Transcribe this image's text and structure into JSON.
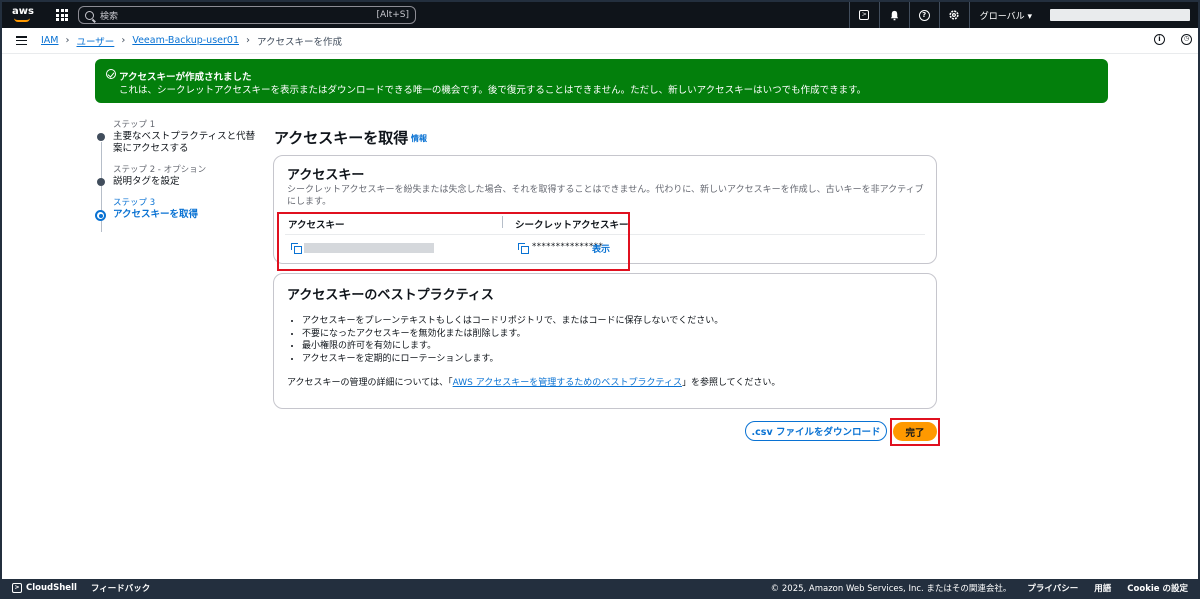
{
  "topnav": {
    "logo": "aws",
    "search_placeholder": "検索",
    "search_shortcut": "[Alt+S]",
    "region": "グローバル ▾",
    "icons": [
      "cloudshell-icon",
      "bell-icon",
      "help-icon",
      "settings-icon"
    ]
  },
  "breadcrumb": {
    "items": [
      "IAM",
      "ユーザー",
      "Veeam-Backup-user01"
    ],
    "current": "アクセスキーを作成"
  },
  "flash": {
    "title": "アクセスキーが作成されました",
    "message": "これは、シークレットアクセスキーを表示またはダウンロードできる唯一の機会です。後で復元することはできません。ただし、新しいアクセスキーはいつでも作成できます。"
  },
  "steps": [
    {
      "label": "ステップ 1",
      "name": "主要なベストプラクティスと代替案にアクセスする"
    },
    {
      "label": "ステップ 2 - オプション",
      "name": "説明タグを設定"
    },
    {
      "label": "ステップ 3",
      "name": "アクセスキーを取得"
    }
  ],
  "page": {
    "title": "アクセスキーを取得",
    "info": "情報"
  },
  "access_key_card": {
    "heading": "アクセスキー",
    "description": "シークレットアクセスキーを紛失または失念した場合、それを取得することはできません。代わりに、新しいアクセスキーを作成し、古いキーを非アクティブにします。",
    "col_access_key": "アクセスキー",
    "col_secret_key": "シークレットアクセスキー",
    "secret_masked": "***************",
    "show_label": "表示"
  },
  "best_practices": {
    "heading": "アクセスキーのベストプラクティス",
    "items": [
      "アクセスキーをプレーンテキストもしくはコードリポジトリで、またはコードに保存しないでください。",
      "不要になったアクセスキーを無効化または削除します。",
      "最小権限の許可を有効にします。",
      "アクセスキーを定期的にローテーションします。"
    ],
    "more_prefix": "アクセスキーの管理の詳細については、「",
    "more_link": "AWS アクセスキーを管理するためのベストプラクティス",
    "more_suffix": "」を参照してください。"
  },
  "buttons": {
    "download_csv": ".csv ファイルをダウンロード",
    "done": "完了"
  },
  "footer": {
    "cloudshell": "CloudShell",
    "feedback": "フィードバック",
    "copyright": "© 2025, Amazon Web Services, Inc. またはその関連会社。",
    "privacy": "プライバシー",
    "terms": "用語",
    "cookie": "Cookie の設定"
  },
  "colors": {
    "accent": "#0972d3",
    "success": "#037f0c",
    "primary_button": "#ff9900",
    "nav": "#0f141a",
    "highlight": "#e0101f"
  }
}
